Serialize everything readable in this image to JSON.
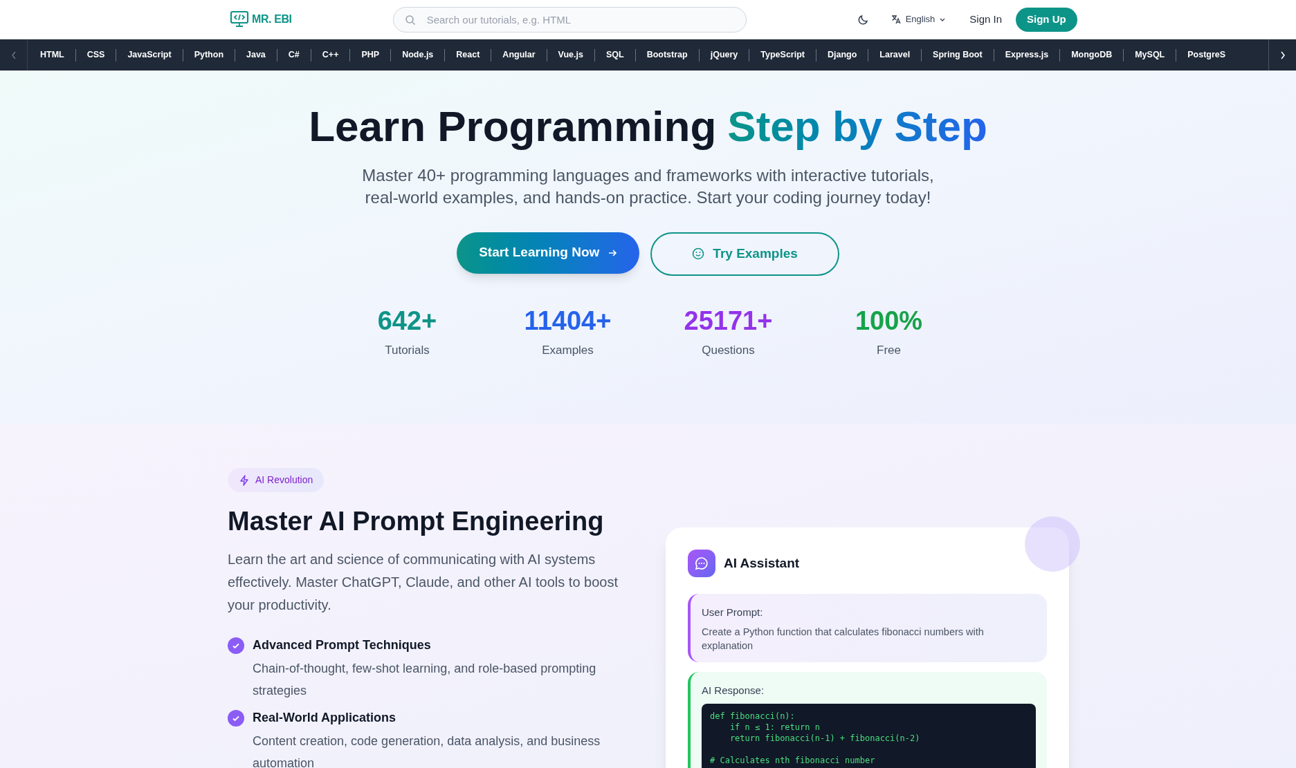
{
  "header": {
    "logo_text": "MR. EBI",
    "search": {
      "placeholder": "Search our tutorials, e.g. HTML"
    },
    "language": "English",
    "sign_in": "Sign In",
    "sign_up": "Sign Up"
  },
  "topics": [
    "HTML",
    "CSS",
    "JavaScript",
    "Python",
    "Java",
    "C#",
    "C++",
    "PHP",
    "Node.js",
    "React",
    "Angular",
    "Vue.js",
    "SQL",
    "Bootstrap",
    "jQuery",
    "TypeScript",
    "Django",
    "Laravel",
    "Spring Boot",
    "Express.js",
    "MongoDB",
    "MySQL",
    "PostgreS"
  ],
  "hero": {
    "title": "Learn Programming",
    "title_highlight": "Step by Step",
    "subtitle": "Master 40+ programming languages and frameworks with interactive tutorials, real-world examples, and hands-on practice. Start your coding journey today!",
    "primary_button": "Start Learning Now",
    "secondary_button": "Try Examples",
    "stats": [
      {
        "value": "642+",
        "label": "Tutorials",
        "color": "#0d9488"
      },
      {
        "value": "11404+",
        "label": "Examples",
        "color": "#2563eb"
      },
      {
        "value": "25171+",
        "label": "Questions",
        "color": "#9333ea"
      },
      {
        "value": "100%",
        "label": "Free",
        "color": "#16a34a"
      }
    ]
  },
  "ai_section": {
    "badge": "AI Revolution",
    "heading": "Master AI Prompt Engineering",
    "description": "Learn the art and science of communicating with AI systems effectively. Master ChatGPT, Claude, and other AI tools to boost your productivity.",
    "features": [
      {
        "title": "Advanced Prompt Techniques",
        "description": "Chain-of-thought, few-shot learning, and role-based prompting strategies"
      },
      {
        "title": "Real-World Applications",
        "description": "Content creation, code generation, data analysis, and business automation"
      }
    ],
    "assistant": {
      "title": "AI Assistant",
      "prompt_label": "User Prompt:",
      "prompt_text": "Create a Python function that calculates fibonacci numbers with explanation",
      "response_label": "AI Response:",
      "code_blocks": [
        [
          "def fibonacci(n):",
          "    if n ≤ 1: return n",
          "    return fibonacci(n-1) + fibonacci(n-2)"
        ],
        [
          "# Calculates nth fibonacci number"
        ]
      ]
    }
  }
}
